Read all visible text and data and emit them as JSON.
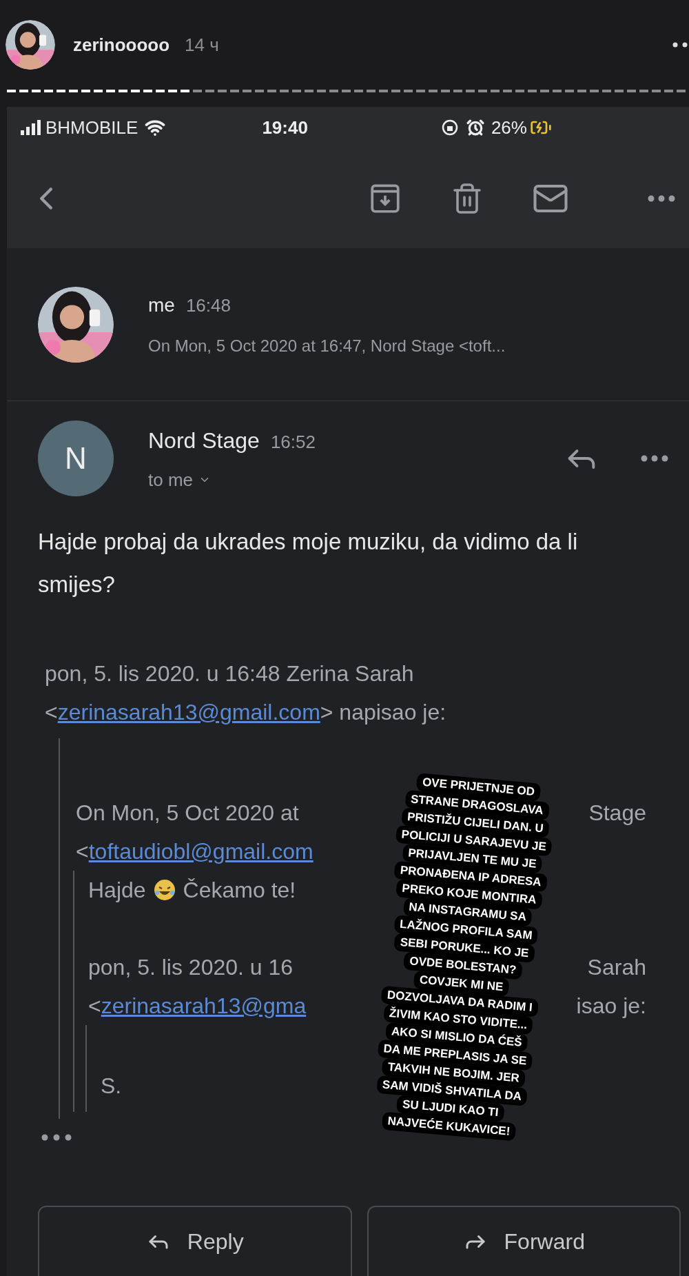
{
  "story": {
    "progress": {
      "level": 0.27
    },
    "username": "zerinooooo",
    "time": "14 ч"
  },
  "status_bar": {
    "carrier": "BHMOBILE",
    "time": "19:40",
    "battery": "26%"
  },
  "thread": [
    {
      "sender": "me",
      "time": "16:48",
      "snippet": "On Mon, 5 Oct 2020 at 16:47, Nord Stage <toft..."
    }
  ],
  "message": {
    "initial": "N",
    "sender": "Nord Stage",
    "time": "16:52",
    "recipient": "to me",
    "body": "Hajde probaj da ukrades moje muziku, da vidimo da li smijes?",
    "quote": {
      "lines": [
        {
          "segments": [
            {
              "text": "pon, 5. lis 2020. u 16:48 Zerina Sarah"
            }
          ]
        },
        {
          "segments": [
            {
              "text": "<"
            },
            {
              "kind": "link",
              "text": "zerinasarah13@gmail.com"
            },
            {
              "text": "> napisao je:"
            }
          ]
        }
      ],
      "nested": {
        "lines": [
          {
            "segments": [
              {
                "text": "On Mon, 5 Oct 2020 at"
              }
            ],
            "trailing": "Stage"
          },
          {
            "segments": [
              {
                "text": "<"
              },
              {
                "kind": "link",
                "text": "toftaudiobl@gmail.com"
              }
            ]
          }
        ],
        "nested": {
          "lines": [
            {
              "segments": [
                {
                  "text": "Hajde"
                },
                {
                  "kind": "emoji"
                },
                {
                  "text": "Čekamo te!"
                }
              ]
            },
            {
              "segments": [
                {
                  "text": "pon, 5. lis 2020. u 16"
                }
              ],
              "trailing": "Sarah"
            },
            {
              "segments": [
                {
                  "text": "<"
                },
                {
                  "kind": "link",
                  "text": "zerinasarah13@gma"
                }
              ],
              "trailing": "isao je:"
            }
          ],
          "nested": {
            "lines": [
              {
                "segments": [
                  {
                    "text": "S."
                  }
                ]
              }
            ]
          }
        }
      }
    }
  },
  "sticker": {
    "lines": [
      "OVE PRIJETNJE OD",
      "STRANE DRAGOSLAVA",
      "PRISTIŽU CIJELI DAN. U",
      "POLICIJI U SARAJEVU JE",
      "PRIJAVLJEN TE MU JE",
      "PRONAĐENA IP ADRESA",
      "PREKO KOJE MONTIRA",
      "NA INSTAGRAMU SA",
      "LAŽNOG PROFILA SAM",
      "SEBI PORUKE... KO JE",
      "OVDE BOLESTAN?",
      "COVJEK MI NE",
      "DOZVOLJAVA DA RADIM I",
      "ŽIVIM KAO STO VIDITE...",
      "AKO SI MISLIO DA ĆEŠ",
      "DA ME PREPLASIS JA SE",
      "TAKVIH NE BOJIM. JER",
      "SAM VIDIŠ SHVATILA DA",
      "SU LJUDI KAO TI",
      "NAJVEĆE KUKAVICE!"
    ]
  },
  "actions": [
    {
      "kind": "reply",
      "label": "Reply"
    },
    {
      "kind": "forward",
      "label": "Forward"
    }
  ]
}
